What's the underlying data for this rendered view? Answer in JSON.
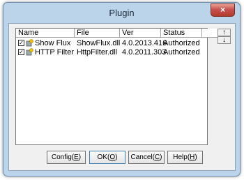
{
  "window": {
    "title": "Plugin",
    "close_label": "×"
  },
  "list": {
    "columns": [
      "Name",
      "File",
      "Ver",
      "Status"
    ],
    "rows": [
      {
        "checked": true,
        "name": "Show Flux",
        "file": "ShowFlux.dll",
        "ver": "4.0.2013.416",
        "status": "Authorized"
      },
      {
        "checked": true,
        "name": "HTTP Filter",
        "file": "HttpFilter.dll",
        "ver": "4.0.2011.303",
        "status": "Authorized"
      }
    ]
  },
  "side_buttons": {
    "up": "↑",
    "down": "↓"
  },
  "buttons": {
    "config": {
      "label": "Config(",
      "key": "E",
      "tail": ")"
    },
    "ok": {
      "label": "OK(",
      "key": "O",
      "tail": ")"
    },
    "cancel": {
      "label": "Cancel(",
      "key": "C",
      "tail": ")"
    },
    "help": {
      "label": "Help(",
      "key": "H",
      "tail": ")"
    }
  },
  "icons": {
    "checkbox": "checkbox-checked-icon",
    "plugin": "plugin-icon"
  },
  "colors": {
    "frame": "#bcd4ea",
    "close": "#c75050"
  }
}
